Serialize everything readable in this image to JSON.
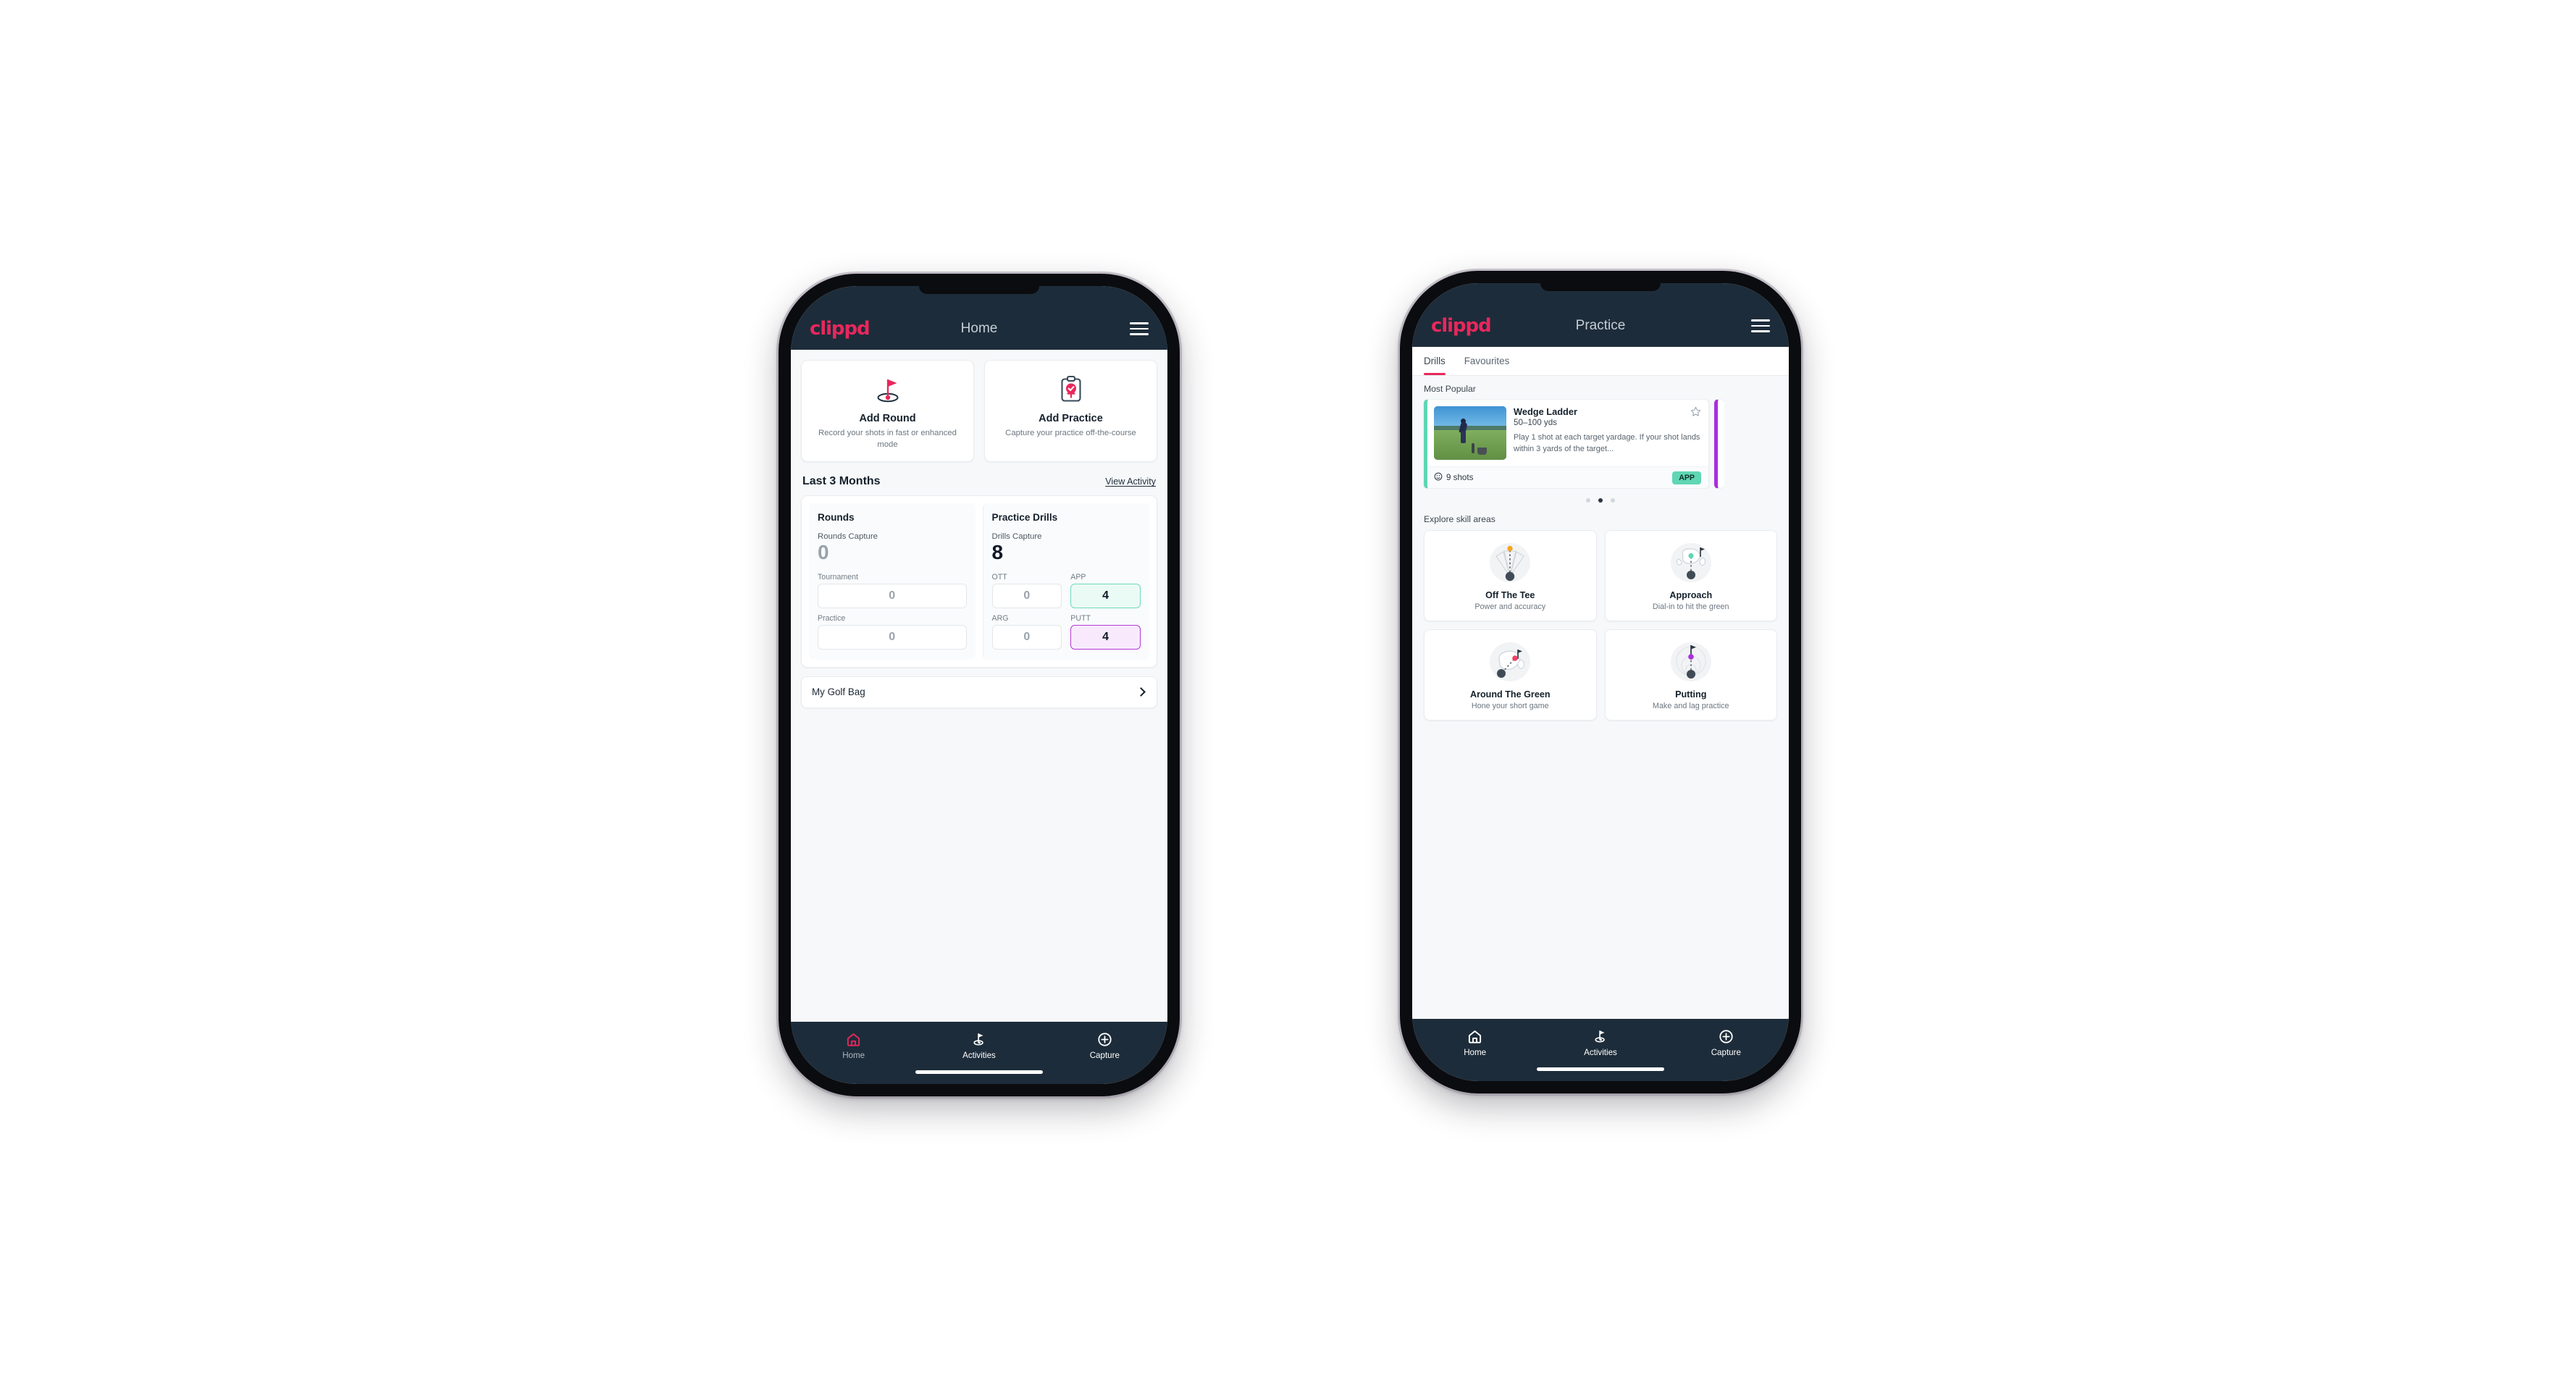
{
  "brand": {
    "logo_text": "clippd",
    "accent_pink": "#e8275c",
    "navy": "#1d2c3a",
    "teal": "#5fd6b4",
    "purple": "#aa2ee0",
    "page_background": "#ffffff"
  },
  "phone_home": {
    "appbar": {
      "title": "Home",
      "logo": "clippd",
      "menu_icon": "hamburger-icon"
    },
    "quick_actions": [
      {
        "icon": "golf-flag-hole-icon",
        "title": "Add Round",
        "subtitle": "Record your shots in fast or enhanced mode"
      },
      {
        "icon": "clipboard-check-tee-icon",
        "title": "Add Practice",
        "subtitle": "Capture your practice off-the-course"
      }
    ],
    "section": {
      "title": "Last 3 Months",
      "link": "View Activity"
    },
    "stats": {
      "rounds": {
        "title": "Rounds",
        "capture_label": "Rounds Capture",
        "capture_value": "0",
        "items": [
          {
            "label": "Tournament",
            "value": "0",
            "style": "plain"
          },
          {
            "label": "Practice",
            "value": "0",
            "style": "plain"
          }
        ]
      },
      "drills": {
        "title": "Practice Drills",
        "capture_label": "Drills Capture",
        "capture_value": "8",
        "items": [
          {
            "label": "OTT",
            "value": "0",
            "style": "plain"
          },
          {
            "label": "APP",
            "value": "4",
            "style": "teal"
          },
          {
            "label": "ARG",
            "value": "0",
            "style": "plain"
          },
          {
            "label": "PUTT",
            "value": "4",
            "style": "purple"
          }
        ]
      }
    },
    "golf_bag": {
      "label": "My Golf Bag",
      "chevron": "chevron-right-icon"
    },
    "bottom_nav": [
      {
        "label": "Home",
        "icon": "home-icon",
        "active": true
      },
      {
        "label": "Activities",
        "icon": "golf-flag-icon",
        "active": false
      },
      {
        "label": "Capture",
        "icon": "plus-circle-icon",
        "active": false
      }
    ]
  },
  "phone_practice": {
    "appbar": {
      "title": "Practice",
      "logo": "clippd",
      "menu_icon": "hamburger-icon"
    },
    "tabs": [
      {
        "label": "Drills",
        "active": true
      },
      {
        "label": "Favourites",
        "active": false
      }
    ],
    "most_popular_label": "Most Popular",
    "drill": {
      "title": "Wedge Ladder",
      "yardage": "50–100 yds",
      "description": "Play 1 shot at each target yardage. If your shot lands within 3 yards of the target...",
      "shots": "9 shots",
      "shots_icon": "clock-icon",
      "badge": "APP",
      "badge_color": "#5fd6b4",
      "favourite_icon": "star-outline-icon",
      "accent_color": "#5fd6b4",
      "thumbnail": "golfer-chipping-photo"
    },
    "next_card_accent": "#aa2ee0",
    "carousel_dots": {
      "count": 3,
      "active_index": 1
    },
    "skill_areas_label": "Explore skill areas",
    "skill_areas": [
      {
        "title": "Off The Tee",
        "subtitle": "Power and accuracy",
        "icon": "tee-dispersion-icon",
        "marker_color": "#f5a623"
      },
      {
        "title": "Approach",
        "subtitle": "Dial-in to hit the green",
        "icon": "green-approach-icon",
        "marker_color": "#5fd6b4"
      },
      {
        "title": "Around The Green",
        "subtitle": "Hone your short game",
        "icon": "chip-green-icon",
        "marker_color": "#e8275c"
      },
      {
        "title": "Putting",
        "subtitle": "Make and lag practice",
        "icon": "putting-rings-icon",
        "marker_color": "#aa2ee0"
      }
    ],
    "bottom_nav": [
      {
        "label": "Home",
        "icon": "home-icon",
        "active": false
      },
      {
        "label": "Activities",
        "icon": "golf-flag-icon",
        "active": false
      },
      {
        "label": "Capture",
        "icon": "plus-circle-icon",
        "active": false
      }
    ]
  }
}
